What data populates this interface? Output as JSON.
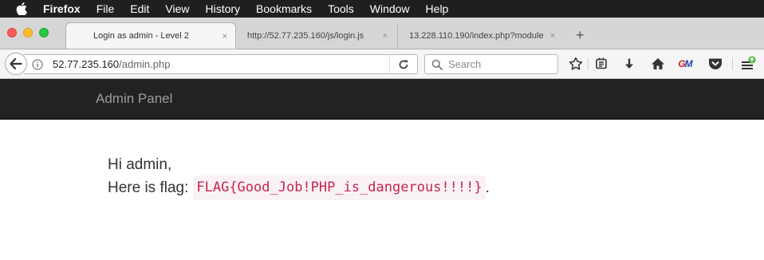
{
  "menubar": {
    "app_name": "Firefox",
    "items": [
      "File",
      "Edit",
      "View",
      "History",
      "Bookmarks",
      "Tools",
      "Window",
      "Help"
    ]
  },
  "tabs": [
    {
      "title": "Login as admin - Level 2",
      "active": true
    },
    {
      "title": "http://52.77.235.160/js/login.js",
      "active": false
    },
    {
      "title": "13.228.110.190/index.php?module",
      "active": false
    }
  ],
  "tab_close_glyph": "×",
  "new_tab_glyph": "+",
  "address_bar": {
    "host": "52.77.235.160",
    "path": "/admin.php"
  },
  "search": {
    "placeholder": "Search"
  },
  "toolbar_icons": [
    "bookmark-star-icon",
    "reader-list-icon",
    "download-icon",
    "home-icon",
    "gm-extension-icon",
    "pocket-icon",
    "menu-icon"
  ],
  "gm_badge": {
    "g": "G",
    "m": "M"
  },
  "site": {
    "brand": "Admin Panel",
    "greeting": "Hi admin,",
    "flag_intro": "Here is flag:",
    "flag": "FLAG{Good_Job!PHP_is_dangerous!!!!}",
    "flag_trailing": "."
  },
  "colors": {
    "site_navbar_bg": "#222222",
    "flag_text": "#c7254e",
    "flag_bg": "#f9f2f4",
    "update_badge": "#3fb536"
  }
}
